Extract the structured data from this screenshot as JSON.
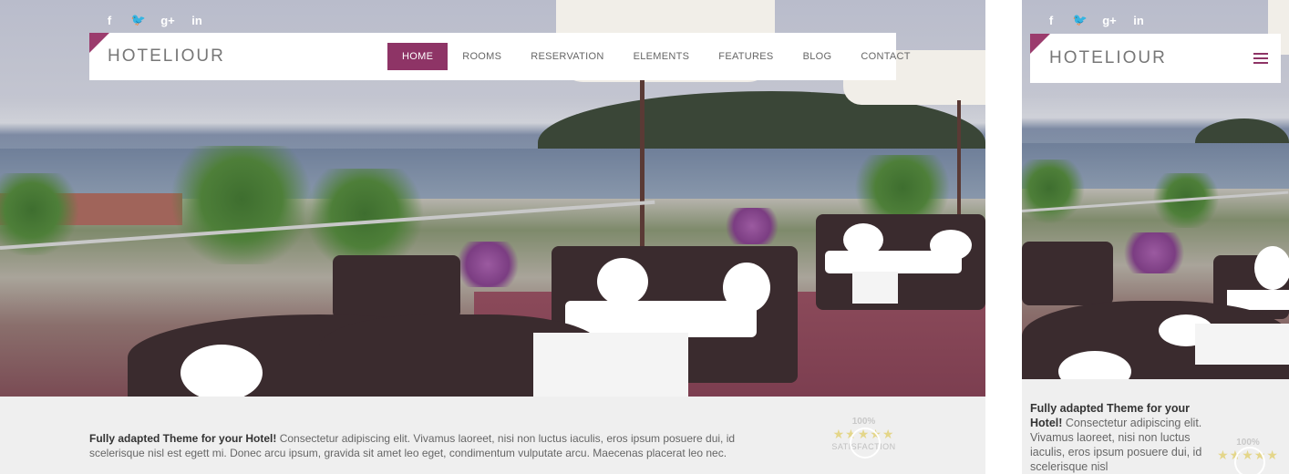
{
  "brand": {
    "logo_text": "HOTELIOUR",
    "accent_color": "#8e3466"
  },
  "social": [
    {
      "name": "facebook-icon",
      "glyph": "f"
    },
    {
      "name": "twitter-icon",
      "glyph": "🐦"
    },
    {
      "name": "google-plus-icon",
      "glyph": "g+"
    },
    {
      "name": "linkedin-icon",
      "glyph": "in"
    }
  ],
  "nav": {
    "items": [
      "HOME",
      "ROOMS",
      "RESERVATION",
      "ELEMENTS",
      "FEATURES",
      "BLOG",
      "CONTACT"
    ],
    "active": "HOME"
  },
  "intro": {
    "bold": "Fully adapted Theme for your Hotel!",
    "body": " Consectetur adipiscing elit. Vivamus laoreet, nisi non luctus iaculis, eros ipsum posuere dui, id scelerisque nisl est egett mi. Donec arcu ipsum, gravida sit amet leo eget, condimentum vulputate arcu. Maecenas placerat leo nec."
  },
  "mobile_intro": {
    "bold": "Fully adapted Theme for your Hotel!",
    "body": " Consectetur adipiscing elit. Vivamus laoreet, nisi non luctus iaculis, eros ipsum posuere dui, id scelerisque nisl"
  },
  "rating": {
    "percent": "100%",
    "stars": "★★★★★",
    "label": "SATISFACTION"
  }
}
